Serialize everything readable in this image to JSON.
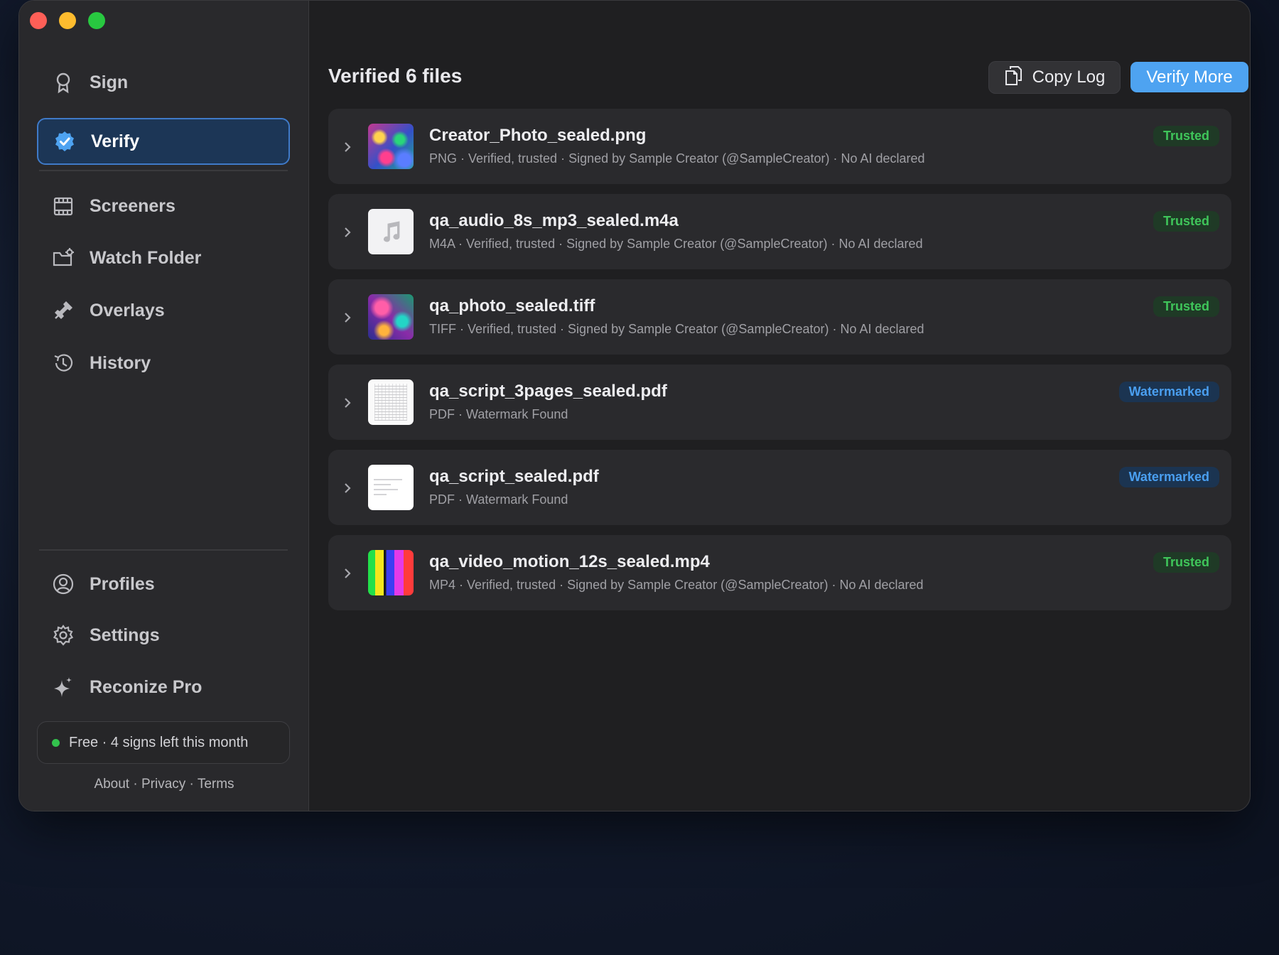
{
  "sidebar": {
    "nav": [
      {
        "label": "Sign",
        "icon": "ribbon-award-icon"
      },
      {
        "label": "Verify",
        "icon": "verified-badge-icon",
        "active": true
      },
      {
        "label": "Screeners",
        "icon": "film-strip-icon"
      },
      {
        "label": "Watch Folder",
        "icon": "folder-gear-icon"
      },
      {
        "label": "Overlays",
        "icon": "stamp-icon"
      },
      {
        "label": "History",
        "icon": "history-clock-icon"
      }
    ],
    "bottom_nav": [
      {
        "label": "Profiles",
        "icon": "person-circle-icon"
      },
      {
        "label": "Settings",
        "icon": "gear-icon"
      },
      {
        "label": "Reconize Pro",
        "icon": "sparkle-icon"
      }
    ],
    "plan": {
      "text": "Free · 4 signs left this month",
      "dot_color": "#33c24d"
    },
    "footer": {
      "about": "About",
      "sep1": " · ",
      "privacy": "Privacy",
      "sep2": " · ",
      "terms": "Terms"
    }
  },
  "main": {
    "title": "Verified 6 files",
    "copy_log_label": "Copy Log",
    "verify_more_label": "Verify More",
    "files": [
      {
        "name": "Creator_Photo_sealed.png",
        "meta": "PNG · Verified, trusted · Signed by Sample Creator (@SampleCreator) · No AI declared",
        "badge": "Trusted",
        "status": "trusted"
      },
      {
        "name": "qa_audio_8s_mp3_sealed.m4a",
        "meta": "M4A · Verified, trusted · Signed by Sample Creator (@SampleCreator) · No AI declared",
        "badge": "Trusted",
        "status": "trusted"
      },
      {
        "name": "qa_photo_sealed.tiff",
        "meta": "TIFF · Verified, trusted · Signed by Sample Creator (@SampleCreator) · No AI declared",
        "badge": "Trusted",
        "status": "trusted"
      },
      {
        "name": "qa_script_3pages_sealed.pdf",
        "meta": "PDF · Watermark Found",
        "badge": "Watermarked",
        "status": "watermarked"
      },
      {
        "name": "qa_script_sealed.pdf",
        "meta": "PDF · Watermark Found",
        "badge": "Watermarked",
        "status": "watermarked"
      },
      {
        "name": "qa_video_motion_12s_sealed.mp4",
        "meta": "MP4 · Verified, trusted · Signed by Sample Creator (@SampleCreator) · No AI declared",
        "badge": "Trusted",
        "status": "trusted"
      }
    ]
  },
  "colors": {
    "accent": "#4ea3f1",
    "trusted": "#3fc55a",
    "watermarked": "#4a9ff0",
    "active_nav_bg": "#1c3656"
  }
}
